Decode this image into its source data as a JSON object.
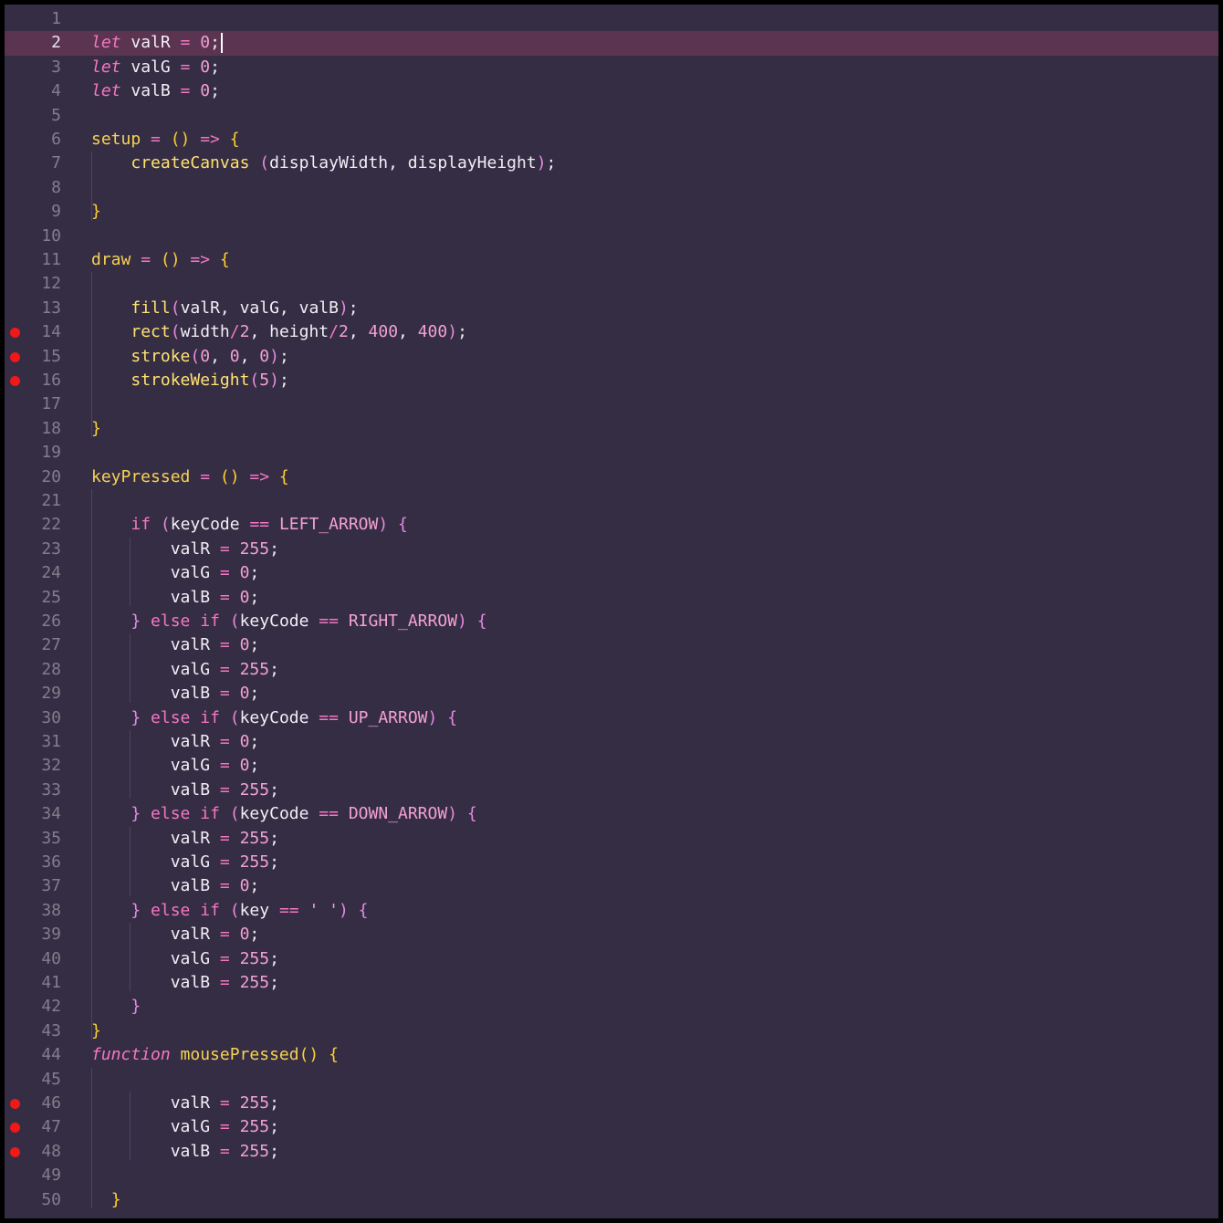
{
  "editor": {
    "current_line": 2,
    "breakpoints": [
      14,
      15,
      16,
      46,
      47,
      48
    ],
    "line_numbers": [
      "1",
      "2",
      "3",
      "4",
      "5",
      "6",
      "7",
      "8",
      "9",
      "10",
      "11",
      "12",
      "13",
      "14",
      "15",
      "16",
      "17",
      "18",
      "19",
      "20",
      "21",
      "22",
      "23",
      "24",
      "25",
      "26",
      "27",
      "28",
      "29",
      "30",
      "31",
      "32",
      "33",
      "34",
      "35",
      "36",
      "37",
      "38",
      "39",
      "40",
      "41",
      "42",
      "43",
      "44",
      "45",
      "46",
      "47",
      "48",
      "49",
      "50"
    ],
    "lines": [
      [],
      [
        [
          "kw",
          "let"
        ],
        [
          "id",
          " valR "
        ],
        [
          "op",
          "="
        ],
        [
          "num",
          " 0"
        ],
        [
          "pn",
          ";"
        ]
      ],
      [
        [
          "kw",
          "let"
        ],
        [
          "id",
          " valG "
        ],
        [
          "op",
          "="
        ],
        [
          "num",
          " 0"
        ],
        [
          "pn",
          ";"
        ]
      ],
      [
        [
          "kw",
          "let"
        ],
        [
          "id",
          " valB "
        ],
        [
          "op",
          "="
        ],
        [
          "num",
          " 0"
        ],
        [
          "pn",
          ";"
        ]
      ],
      [],
      [
        [
          "fn",
          "setup"
        ],
        [
          "op",
          " = "
        ],
        [
          "br",
          "() "
        ],
        [
          "op",
          "=>"
        ],
        [
          "br",
          " {"
        ]
      ],
      [
        [
          "id",
          "    "
        ],
        [
          "fnc",
          "createCanvas"
        ],
        [
          "bp2",
          " ("
        ],
        [
          "id",
          "displayWidth, displayHeight"
        ],
        [
          "bp2",
          ")"
        ],
        [
          "pn",
          ";"
        ]
      ],
      [],
      [
        [
          "br",
          "}"
        ]
      ],
      [],
      [
        [
          "fn",
          "draw"
        ],
        [
          "op",
          " = "
        ],
        [
          "br",
          "() "
        ],
        [
          "op",
          "=>"
        ],
        [
          "br",
          " {"
        ]
      ],
      [],
      [
        [
          "id",
          "    "
        ],
        [
          "fnc",
          "fill"
        ],
        [
          "bp2",
          "("
        ],
        [
          "id",
          "valR, valG, valB"
        ],
        [
          "bp2",
          ")"
        ],
        [
          "pn",
          ";"
        ]
      ],
      [
        [
          "id",
          "    "
        ],
        [
          "fnc",
          "rect"
        ],
        [
          "bp2",
          "("
        ],
        [
          "id",
          "width"
        ],
        [
          "op",
          "/"
        ],
        [
          "num",
          "2"
        ],
        [
          "id",
          ", height"
        ],
        [
          "op",
          "/"
        ],
        [
          "num",
          "2"
        ],
        [
          "id",
          ", "
        ],
        [
          "num",
          "400"
        ],
        [
          "id",
          ", "
        ],
        [
          "num",
          "400"
        ],
        [
          "bp2",
          ")"
        ],
        [
          "pn",
          ";"
        ]
      ],
      [
        [
          "id",
          "    "
        ],
        [
          "fnc",
          "stroke"
        ],
        [
          "bp2",
          "("
        ],
        [
          "num",
          "0"
        ],
        [
          "id",
          ", "
        ],
        [
          "num",
          "0"
        ],
        [
          "id",
          ", "
        ],
        [
          "num",
          "0"
        ],
        [
          "bp2",
          ")"
        ],
        [
          "pn",
          ";"
        ]
      ],
      [
        [
          "id",
          "    "
        ],
        [
          "fnc",
          "strokeWeight"
        ],
        [
          "bp2",
          "("
        ],
        [
          "num",
          "5"
        ],
        [
          "bp2",
          ")"
        ],
        [
          "pn",
          ";"
        ]
      ],
      [],
      [
        [
          "br",
          "}"
        ]
      ],
      [],
      [
        [
          "fn",
          "keyPressed"
        ],
        [
          "op",
          " = "
        ],
        [
          "br",
          "() "
        ],
        [
          "op",
          "=>"
        ],
        [
          "br",
          " {"
        ]
      ],
      [],
      [
        [
          "id",
          "    "
        ],
        [
          "ctl",
          "if"
        ],
        [
          "bp2",
          " ("
        ],
        [
          "id",
          "keyCode "
        ],
        [
          "op",
          "=="
        ],
        [
          "const",
          " LEFT_ARROW"
        ],
        [
          "bp2",
          ")"
        ],
        [
          "bp2",
          " {"
        ]
      ],
      [
        [
          "id",
          "        valR "
        ],
        [
          "op",
          "="
        ],
        [
          "num",
          " 255"
        ],
        [
          "pn",
          ";"
        ]
      ],
      [
        [
          "id",
          "        valG "
        ],
        [
          "op",
          "="
        ],
        [
          "num",
          " 0"
        ],
        [
          "pn",
          ";"
        ]
      ],
      [
        [
          "id",
          "        valB "
        ],
        [
          "op",
          "="
        ],
        [
          "num",
          " 0"
        ],
        [
          "pn",
          ";"
        ]
      ],
      [
        [
          "id",
          "    "
        ],
        [
          "bp2",
          "} "
        ],
        [
          "ctl",
          "else if"
        ],
        [
          "bp2",
          " ("
        ],
        [
          "id",
          "keyCode "
        ],
        [
          "op",
          "=="
        ],
        [
          "const",
          " RIGHT_ARROW"
        ],
        [
          "bp2",
          ")"
        ],
        [
          "bp2",
          " {"
        ]
      ],
      [
        [
          "id",
          "        valR "
        ],
        [
          "op",
          "="
        ],
        [
          "num",
          " 0"
        ],
        [
          "pn",
          ";"
        ]
      ],
      [
        [
          "id",
          "        valG "
        ],
        [
          "op",
          "="
        ],
        [
          "num",
          " 255"
        ],
        [
          "pn",
          ";"
        ]
      ],
      [
        [
          "id",
          "        valB "
        ],
        [
          "op",
          "="
        ],
        [
          "num",
          " 0"
        ],
        [
          "pn",
          ";"
        ]
      ],
      [
        [
          "id",
          "    "
        ],
        [
          "bp2",
          "} "
        ],
        [
          "ctl",
          "else if"
        ],
        [
          "bp2",
          " ("
        ],
        [
          "id",
          "keyCode "
        ],
        [
          "op",
          "=="
        ],
        [
          "const",
          " UP_ARROW"
        ],
        [
          "bp2",
          ")"
        ],
        [
          "bp2",
          " {"
        ]
      ],
      [
        [
          "id",
          "        valR "
        ],
        [
          "op",
          "="
        ],
        [
          "num",
          " 0"
        ],
        [
          "pn",
          ";"
        ]
      ],
      [
        [
          "id",
          "        valG "
        ],
        [
          "op",
          "="
        ],
        [
          "num",
          " 0"
        ],
        [
          "pn",
          ";"
        ]
      ],
      [
        [
          "id",
          "        valB "
        ],
        [
          "op",
          "="
        ],
        [
          "num",
          " 255"
        ],
        [
          "pn",
          ";"
        ]
      ],
      [
        [
          "id",
          "    "
        ],
        [
          "bp2",
          "} "
        ],
        [
          "ctl",
          "else if"
        ],
        [
          "bp2",
          " ("
        ],
        [
          "id",
          "keyCode "
        ],
        [
          "op",
          "=="
        ],
        [
          "const",
          " DOWN_ARROW"
        ],
        [
          "bp2",
          ")"
        ],
        [
          "bp2",
          " {"
        ]
      ],
      [
        [
          "id",
          "        valR "
        ],
        [
          "op",
          "="
        ],
        [
          "num",
          " 255"
        ],
        [
          "pn",
          ";"
        ]
      ],
      [
        [
          "id",
          "        valG "
        ],
        [
          "op",
          "="
        ],
        [
          "num",
          " 255"
        ],
        [
          "pn",
          ";"
        ]
      ],
      [
        [
          "id",
          "        valB "
        ],
        [
          "op",
          "="
        ],
        [
          "num",
          " 0"
        ],
        [
          "pn",
          ";"
        ]
      ],
      [
        [
          "id",
          "    "
        ],
        [
          "bp2",
          "} "
        ],
        [
          "ctl",
          "else if"
        ],
        [
          "bp2",
          " ("
        ],
        [
          "id",
          "key "
        ],
        [
          "op",
          "=="
        ],
        [
          "num",
          " ' '"
        ],
        [
          "bp2",
          ")"
        ],
        [
          "bp2",
          " {"
        ]
      ],
      [
        [
          "id",
          "        valR "
        ],
        [
          "op",
          "="
        ],
        [
          "num",
          " 0"
        ],
        [
          "pn",
          ";"
        ]
      ],
      [
        [
          "id",
          "        valG "
        ],
        [
          "op",
          "="
        ],
        [
          "num",
          " 255"
        ],
        [
          "pn",
          ";"
        ]
      ],
      [
        [
          "id",
          "        valB "
        ],
        [
          "op",
          "="
        ],
        [
          "num",
          " 255"
        ],
        [
          "pn",
          ";"
        ]
      ],
      [
        [
          "id",
          "    "
        ],
        [
          "bp2",
          "}"
        ]
      ],
      [
        [
          "br",
          "}"
        ]
      ],
      [
        [
          "kw",
          "function"
        ],
        [
          "fn",
          " mousePressed"
        ],
        [
          "br",
          "() {"
        ]
      ],
      [],
      [
        [
          "id",
          "        valR "
        ],
        [
          "op",
          "="
        ],
        [
          "num",
          " 255"
        ],
        [
          "pn",
          ";"
        ]
      ],
      [
        [
          "id",
          "        valG "
        ],
        [
          "op",
          "="
        ],
        [
          "num",
          " 255"
        ],
        [
          "pn",
          ";"
        ]
      ],
      [
        [
          "id",
          "        valB "
        ],
        [
          "op",
          "="
        ],
        [
          "num",
          " 255"
        ],
        [
          "pn",
          ";"
        ]
      ],
      [],
      [
        [
          "id",
          "  "
        ],
        [
          "br",
          "}"
        ]
      ]
    ]
  }
}
